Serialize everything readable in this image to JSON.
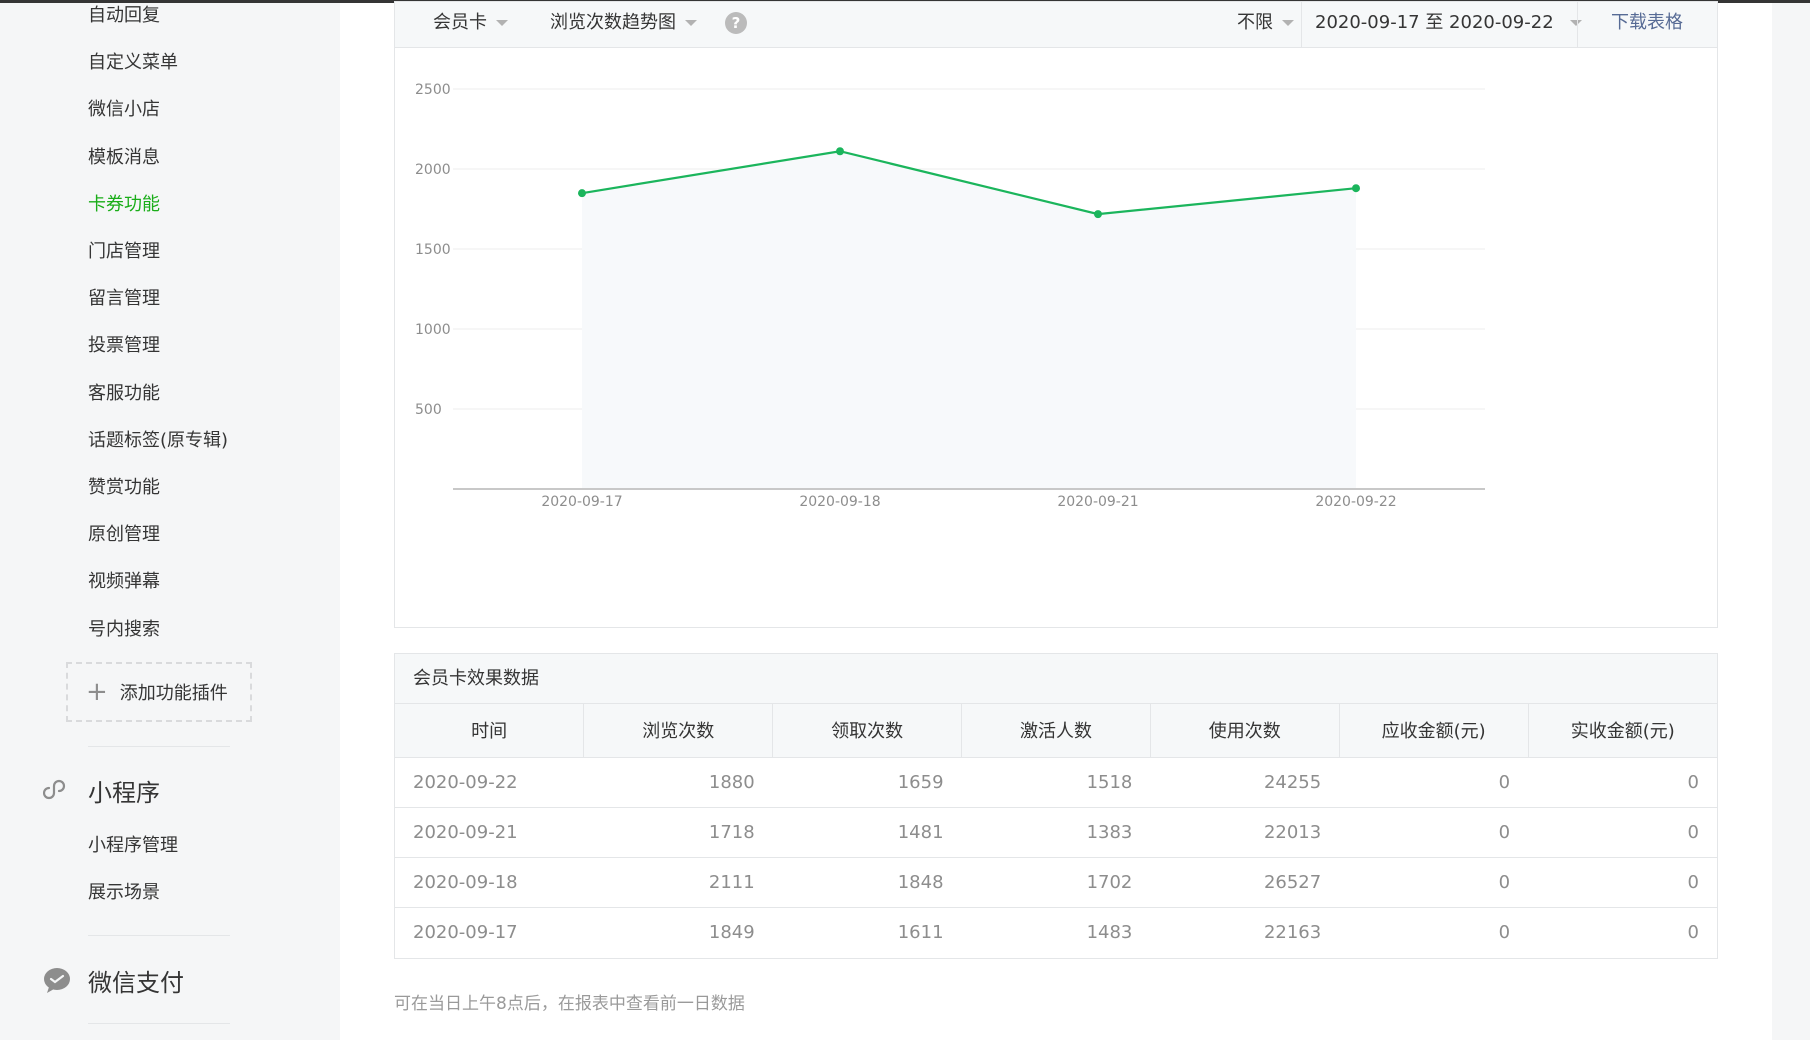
{
  "sidebar": {
    "items": [
      {
        "label": "自动回复",
        "active": false
      },
      {
        "label": "自定义菜单",
        "active": false
      },
      {
        "label": "微信小店",
        "active": false
      },
      {
        "label": "模板消息",
        "active": false
      },
      {
        "label": "卡券功能",
        "active": true
      },
      {
        "label": "门店管理",
        "active": false
      },
      {
        "label": "留言管理",
        "active": false
      },
      {
        "label": "投票管理",
        "active": false
      },
      {
        "label": "客服功能",
        "active": false
      },
      {
        "label": "话题标签(原专辑)",
        "active": false
      },
      {
        "label": "赞赏功能",
        "active": false
      },
      {
        "label": "原创管理",
        "active": false
      },
      {
        "label": "视频弹幕",
        "active": false
      },
      {
        "label": "号内搜索",
        "active": false
      }
    ],
    "add_plugin_label": "添加功能插件",
    "miniprogram": {
      "title": "小程序",
      "icon": "link-icon",
      "items": [
        "小程序管理",
        "展示场景"
      ]
    },
    "wechat_pay": {
      "title": "微信支付",
      "icon": "chat-bubble-icon"
    }
  },
  "toolbar": {
    "card_type": "会员卡",
    "metric": "浏览次数趋势图",
    "filter": "不限",
    "date_range": "2020-09-17 至 2020-09-22",
    "download_label": "下载表格"
  },
  "colors": {
    "accent": "#1aad19",
    "line": "#1bb55c",
    "link": "#576b95"
  },
  "chart_data": {
    "type": "line",
    "categories": [
      "2020-09-17",
      "2020-09-18",
      "2020-09-21",
      "2020-09-22"
    ],
    "values": [
      1849,
      2111,
      1718,
      1880
    ],
    "y_ticks": [
      500,
      1000,
      1500,
      2000,
      2500
    ],
    "ylim": [
      0,
      2500
    ],
    "grid": true
  },
  "table": {
    "title": "会员卡效果数据",
    "columns": [
      "时间",
      "浏览次数",
      "领取次数",
      "激活人数",
      "使用次数",
      "应收金额(元)",
      "实收金额(元)"
    ],
    "rows": [
      [
        "2020-09-22",
        "1880",
        "1659",
        "1518",
        "24255",
        "0",
        "0"
      ],
      [
        "2020-09-21",
        "1718",
        "1481",
        "1383",
        "22013",
        "0",
        "0"
      ],
      [
        "2020-09-18",
        "2111",
        "1848",
        "1702",
        "26527",
        "0",
        "0"
      ],
      [
        "2020-09-17",
        "1849",
        "1611",
        "1483",
        "22163",
        "0",
        "0"
      ]
    ]
  },
  "footnote": "可在当日上午8点后，在报表中查看前一日数据"
}
